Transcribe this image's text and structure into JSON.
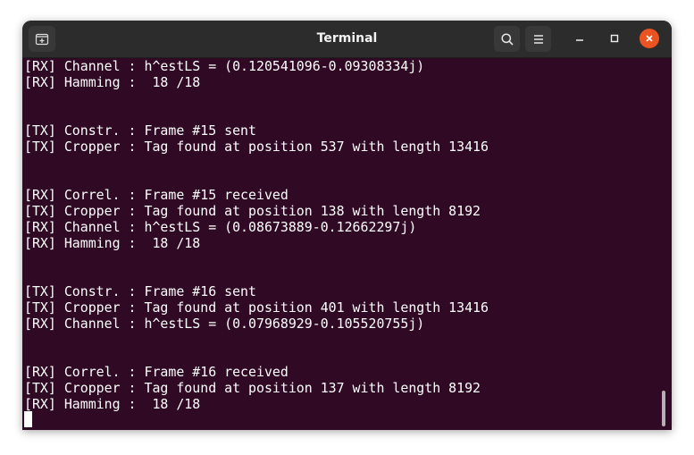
{
  "window": {
    "title": "Terminal"
  },
  "titlebar": {
    "icons": {
      "new_tab": "new-tab-icon",
      "search": "search-icon",
      "menu": "hamburger-menu-icon",
      "minimize": "minimize-icon",
      "maximize": "maximize-icon",
      "close": "close-icon"
    }
  },
  "colors": {
    "terminal_bg": "#300a24",
    "titlebar_bg": "#2c2c2c",
    "close_accent": "#e95420",
    "text": "#ffffff"
  },
  "terminal": {
    "lines": [
      "[RX] Channel : h^estLS = (0.120541096-0.09308334j)",
      "[RX] Hamming :  18 /18",
      "",
      "",
      "[TX] Constr. : Frame #15 sent",
      "[TX] Cropper : Tag found at position 537 with length 13416",
      "",
      "",
      "[RX] Correl. : Frame #15 received",
      "[TX] Cropper : Tag found at position 138 with length 8192",
      "[RX] Channel : h^estLS = (0.08673889-0.12662297j)",
      "[RX] Hamming :  18 /18",
      "",
      "",
      "[TX] Constr. : Frame #16 sent",
      "[TX] Cropper : Tag found at position 401 with length 13416",
      "[RX] Channel : h^estLS = (0.07968929-0.105520755j)",
      "",
      "",
      "[RX] Correl. : Frame #16 received",
      "[TX] Cropper : Tag found at position 137 with length 8192",
      "[RX] Hamming :  18 /18"
    ]
  }
}
